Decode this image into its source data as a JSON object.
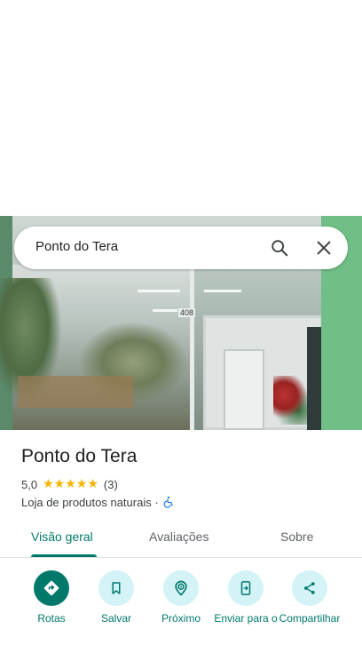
{
  "search": {
    "query": "Ponto do Tera"
  },
  "photo": {
    "sign_number": "408"
  },
  "place": {
    "name": "Ponto do Tera",
    "rating": "5,0",
    "stars": [
      "★",
      "★",
      "★",
      "★",
      "★"
    ],
    "review_count": "(3)",
    "category": "Loja de produtos naturais · "
  },
  "tabs": [
    {
      "label": "Visão geral",
      "active": true
    },
    {
      "label": "Avaliações",
      "active": false
    },
    {
      "label": "Sobre",
      "active": false
    }
  ],
  "actions": [
    {
      "label": "Rotas",
      "icon": "directions-icon"
    },
    {
      "label": "Salvar",
      "icon": "bookmark-icon"
    },
    {
      "label": "Próximo",
      "icon": "nearby-icon"
    },
    {
      "label": "Enviar para o",
      "icon": "send-to-phone-icon"
    },
    {
      "label": "Compartilhar",
      "icon": "share-icon"
    }
  ],
  "colors": {
    "accent": "#00796b",
    "action_bg": "#d3f3f7",
    "star": "#f5b400",
    "wheelchair": "#1a73e8"
  }
}
